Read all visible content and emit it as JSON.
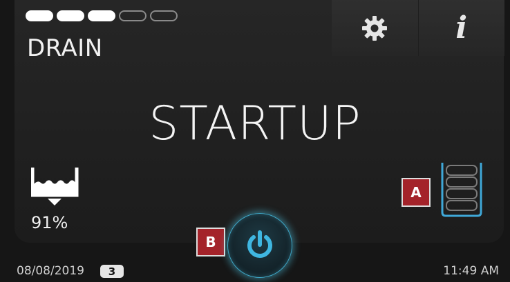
{
  "header": {
    "progress": {
      "filled": 3,
      "total": 5
    },
    "mode_label": "DRAIN",
    "buttons": [
      {
        "name": "settings",
        "icon": "gear-icon"
      },
      {
        "name": "info",
        "icon": "info-icon",
        "glyph": "i"
      }
    ]
  },
  "main": {
    "status_text": "STARTUP",
    "tank_level": {
      "icon": "tank-level-icon",
      "value": "91%"
    },
    "battery": {
      "icon": "battery-icon",
      "segments_total": 4,
      "color": "#3fa8d8"
    }
  },
  "markers": {
    "a": "A",
    "b": "B"
  },
  "power": {
    "icon": "power-icon",
    "color": "#3fb6e0"
  },
  "footer": {
    "date": "08/08/2019",
    "badge": "3",
    "time": "11:49 AM"
  }
}
